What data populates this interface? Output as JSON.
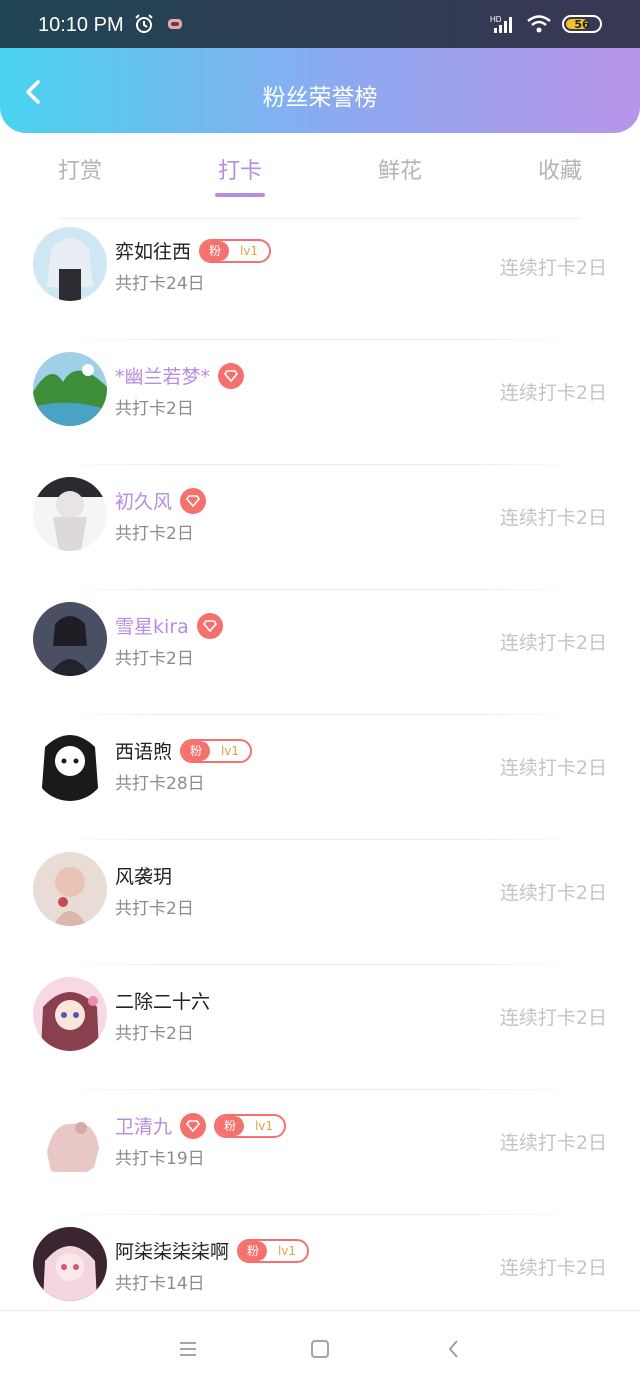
{
  "status_bar": {
    "time": "10:10 PM",
    "battery": "56",
    "network": "HD"
  },
  "header": {
    "title": "粉丝荣誉榜"
  },
  "tabs": [
    {
      "label": "打赏",
      "active": false
    },
    {
      "label": "打卡",
      "active": true
    },
    {
      "label": "鲜花",
      "active": false
    },
    {
      "label": "收藏",
      "active": false
    }
  ],
  "rows": [
    {
      "name": "弈如往西",
      "vip": false,
      "gem": false,
      "fan_badge": true,
      "fan_label": "粉",
      "fan_level": "lv1",
      "total": "共打卡24日",
      "streak": "连续打卡2日"
    },
    {
      "name": "*幽兰若梦*",
      "vip": true,
      "gem": true,
      "fan_badge": false,
      "fan_label": "",
      "fan_level": "",
      "total": "共打卡2日",
      "streak": "连续打卡2日"
    },
    {
      "name": "初久风",
      "vip": true,
      "gem": true,
      "fan_badge": false,
      "fan_label": "",
      "fan_level": "",
      "total": "共打卡2日",
      "streak": "连续打卡2日"
    },
    {
      "name": "雪星kira",
      "vip": true,
      "gem": true,
      "fan_badge": false,
      "fan_label": "",
      "fan_level": "",
      "total": "共打卡2日",
      "streak": "连续打卡2日"
    },
    {
      "name": "西语煦",
      "vip": false,
      "gem": false,
      "fan_badge": true,
      "fan_label": "粉",
      "fan_level": "lv1",
      "total": "共打卡28日",
      "streak": "连续打卡2日"
    },
    {
      "name": "风袭玥",
      "vip": false,
      "gem": false,
      "fan_badge": false,
      "fan_label": "",
      "fan_level": "",
      "total": "共打卡2日",
      "streak": "连续打卡2日"
    },
    {
      "name": "二除二十六",
      "vip": false,
      "gem": false,
      "fan_badge": false,
      "fan_label": "",
      "fan_level": "",
      "total": "共打卡2日",
      "streak": "连续打卡2日"
    },
    {
      "name": "卫清九",
      "vip": true,
      "gem": true,
      "fan_badge": true,
      "fan_label": "粉",
      "fan_level": "lv1",
      "total": "共打卡19日",
      "streak": "连续打卡2日"
    },
    {
      "name": "阿柒柒柒柒啊",
      "vip": false,
      "gem": false,
      "fan_badge": true,
      "fan_label": "粉",
      "fan_level": "lv1",
      "total": "共打卡14日",
      "streak": "连续打卡2日"
    }
  ],
  "colors": {
    "accent": "#b78de0",
    "badge": "#f4716e",
    "level": "#e8a23a",
    "gradient_start": "#49d3f0",
    "gradient_end": "#b895ea"
  },
  "icons": {
    "back": "chevron-left-icon",
    "gem": "diamond-icon",
    "nav_menu": "menu-icon",
    "nav_home": "square-icon",
    "nav_back": "back-icon"
  }
}
